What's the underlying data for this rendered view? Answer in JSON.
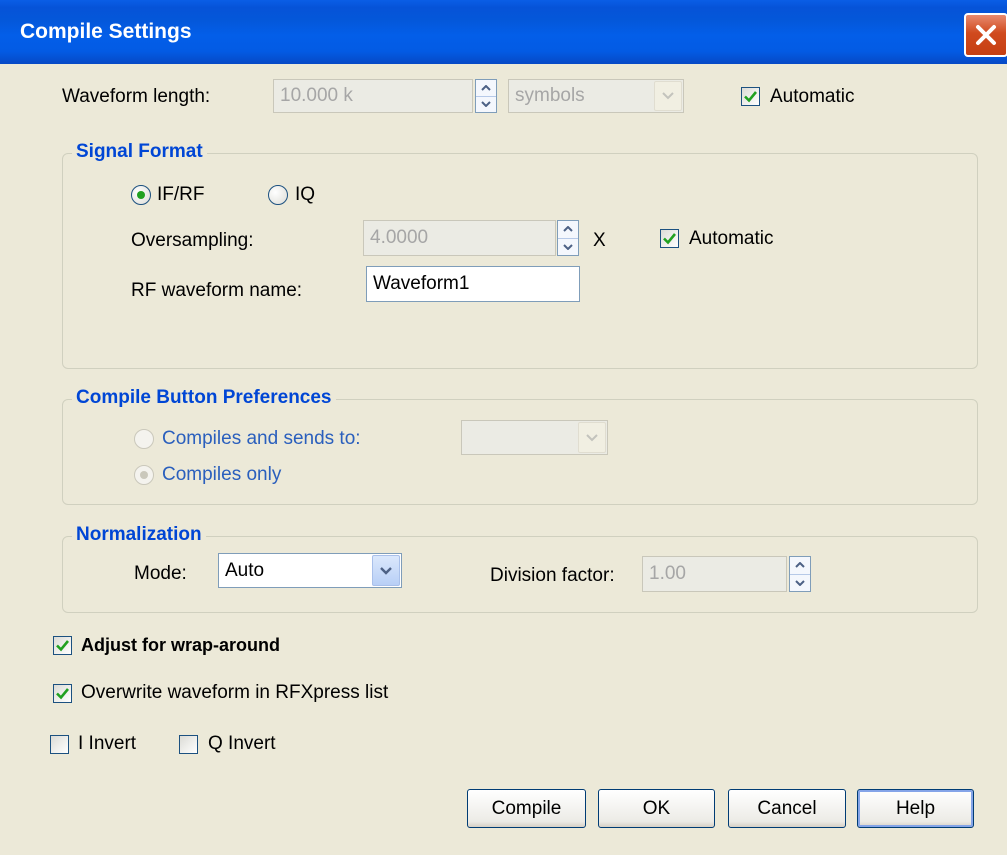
{
  "window": {
    "title": "Compile Settings"
  },
  "waveform_length": {
    "label": "Waveform length:",
    "value": "10.000 k",
    "unit": "symbols",
    "automatic_label": "Automatic",
    "automatic_checked": true
  },
  "signal_format": {
    "title": "Signal Format",
    "ifrf_label": "IF/RF",
    "iq_label": "IQ",
    "selected": "IF/RF",
    "oversampling_label": "Oversampling:",
    "oversampling_value": "4.0000",
    "oversampling_unit": "X",
    "automatic_label": "Automatic",
    "automatic_checked": true,
    "rf_name_label": "RF waveform name:",
    "rf_name_value": "Waveform1"
  },
  "compile_prefs": {
    "title": "Compile Button Preferences",
    "sends_label": "Compiles and sends to:",
    "sends_value": "",
    "only_label": "Compiles only",
    "selected": "Compiles only"
  },
  "normalization": {
    "title": "Normalization",
    "mode_label": "Mode:",
    "mode_value": "Auto",
    "division_label": "Division factor:",
    "division_value": "1.00"
  },
  "options": {
    "wrap_label": "Adjust for wrap-around",
    "wrap_checked": true,
    "overwrite_label": "Overwrite waveform in RFXpress list",
    "overwrite_checked": true,
    "i_invert_label": "I Invert",
    "i_invert_checked": false,
    "q_invert_label": "Q Invert",
    "q_invert_checked": false
  },
  "buttons": {
    "compile": "Compile",
    "ok": "OK",
    "cancel": "Cancel",
    "help": "Help"
  },
  "colors": {
    "titlebar": "#0457d9",
    "group_title": "#0046d5",
    "check_mark": "#21a121",
    "close_button": "#d04a1e",
    "dialog_bg": "#ece9d8"
  },
  "icons": {
    "close": "close-icon",
    "check": "check-mark-icon",
    "spin_up": "spin-up-icon",
    "spin_down": "spin-down-icon",
    "dropdown": "chevron-down-icon"
  }
}
